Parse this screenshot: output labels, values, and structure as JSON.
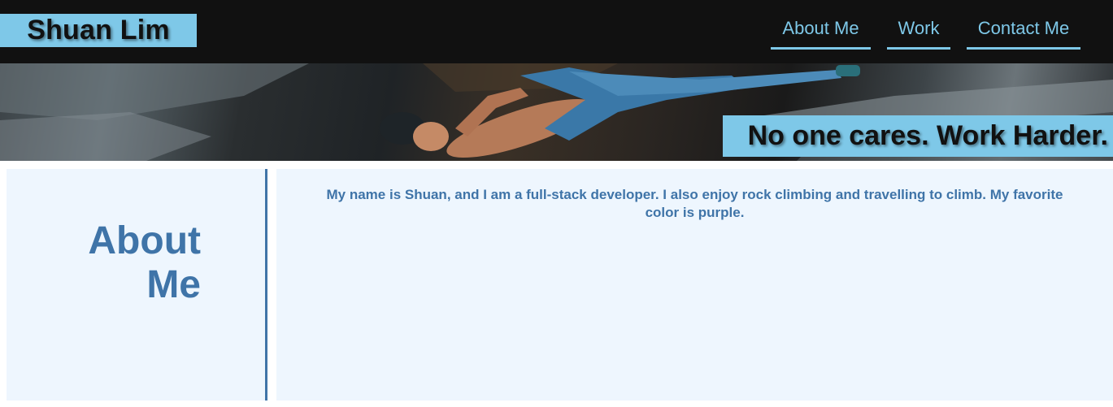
{
  "header": {
    "logo_text": "Shuan Lim",
    "nav": [
      {
        "label": "About Me"
      },
      {
        "label": "Work"
      },
      {
        "label": "Contact Me"
      }
    ]
  },
  "hero": {
    "tagline": "No one cares. Work Harder."
  },
  "about": {
    "title": "About Me",
    "body": "My name is Shuan, and I am a full-stack developer. I also enjoy rock climbing and travelling to climb. My favorite color is purple."
  },
  "colors": {
    "accent": "#7ec8e8",
    "header_bg": "#111111",
    "section_bg": "#eef6fe",
    "section_text": "#3f74a8"
  }
}
